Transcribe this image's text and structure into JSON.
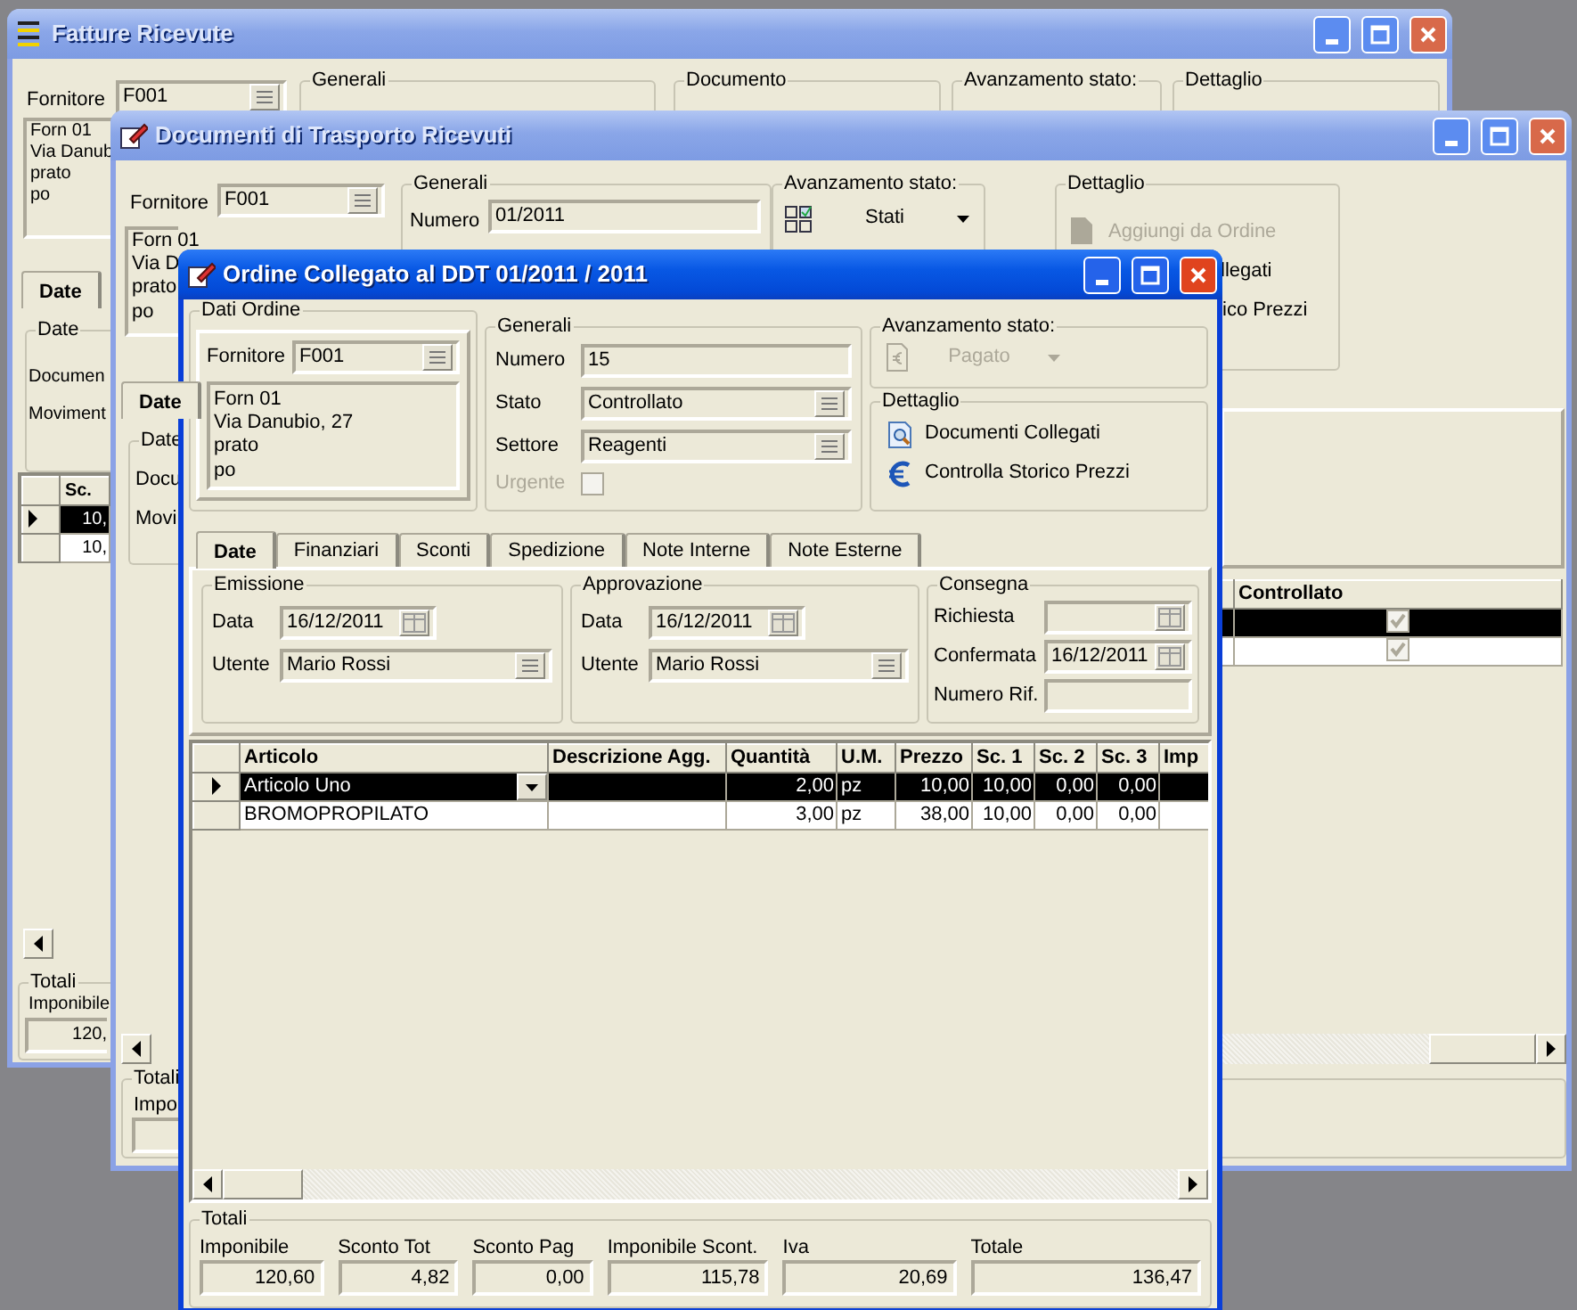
{
  "invoices_window": {
    "title": "Fatture Ricevute",
    "active": false,
    "supplier_label": "Fornitore",
    "supplier_code": "F001",
    "group_titles": [
      "Generali",
      "Documento",
      "Avanzamento stato:",
      "Dettaglio"
    ],
    "address_lines": [
      "Forn 01",
      "Via Danub",
      "prato",
      "po"
    ],
    "tab": {
      "label": "Date",
      "selected": true
    },
    "dates_group": "Date",
    "date_labels": [
      "Documen",
      "Moviment"
    ],
    "grid_column": "Sc.",
    "grid_rows": [
      {
        "value": "10,",
        "selected": true
      },
      {
        "value": "10,",
        "selected": false
      }
    ],
    "totals_title": "Totali",
    "totals_label": "Imponibile",
    "totals_value": "120,"
  },
  "transport_window": {
    "title": "Documenti di Trasporto Ricevuti",
    "active": false,
    "supplier_label": "Fornitore",
    "supplier_code": "F001",
    "address_lines": [
      "Forn 01",
      "Via D",
      "prato",
      "po"
    ],
    "general_title": "Generali",
    "number_label": "Numero",
    "number_value": "01/2011",
    "status_title": "Avanzamento stato:",
    "status_button": "Stati",
    "detail_title": "Dettaglio",
    "detail_actions": [
      {
        "label": "Aggiungi da Ordine",
        "disabled": true
      },
      {
        "label": "llegati",
        "disabled": false
      },
      {
        "label": "ico Prezzi",
        "disabled": false
      }
    ],
    "tab": {
      "label": "Date",
      "selected": true
    },
    "dates_group": "Date",
    "date_labels": [
      "Docu",
      "Movi"
    ],
    "grid_column": "Controllato",
    "grid_rows": [
      {
        "selected": true,
        "checked": true
      },
      {
        "selected": false,
        "checked": true
      }
    ],
    "totals_title": "Totali",
    "totals_label": "Impo"
  },
  "order_window": {
    "title": "Ordine Collegato al DDT 01/2011 / 2011",
    "active": true,
    "order_group": {
      "title": "Dati Ordine",
      "supplier_label": "Fornitore",
      "supplier_code": "F001",
      "address_lines": [
        "Forn 01",
        "Via Danubio, 27",
        "prato",
        "po"
      ]
    },
    "general_group": {
      "title": "Generali",
      "fields": [
        {
          "label": "Numero",
          "value": "15",
          "kind": "text"
        },
        {
          "label": "Stato",
          "value": "Controllato",
          "kind": "lookup"
        },
        {
          "label": "Settore",
          "value": "Reagenti",
          "kind": "lookup"
        }
      ],
      "urgent": {
        "label": "Urgente",
        "checked": false,
        "disabled": true
      }
    },
    "status_group": {
      "title": "Avanzamento stato:",
      "button": "Pagato",
      "disabled": true
    },
    "detail_group": {
      "title": "Dettaglio",
      "actions": [
        {
          "label": "Documenti Collegati",
          "kind": "documents"
        },
        {
          "label": "Controlla Storico Prezzi",
          "kind": "prices"
        }
      ]
    },
    "tabs": [
      {
        "label": "Date",
        "selected": true
      },
      {
        "label": "Finanziari",
        "selected": false
      },
      {
        "label": "Sconti",
        "selected": false
      },
      {
        "label": "Spedizione",
        "selected": false
      },
      {
        "label": "Note Interne",
        "selected": false
      },
      {
        "label": "Note Esterne",
        "selected": false
      }
    ],
    "emission": {
      "title": "Emissione",
      "date_label": "Data",
      "date": "16/12/2011",
      "user_label": "Utente",
      "user": "Mario Rossi"
    },
    "approval": {
      "title": "Approvazione",
      "date_label": "Data",
      "date": "16/12/2011",
      "user_label": "Utente",
      "user": "Mario Rossi"
    },
    "delivery": {
      "title": "Consegna",
      "fields": [
        {
          "label": "Richiesta",
          "kind": "date"
        },
        {
          "label": "Confermata",
          "value": "16/12/2011",
          "kind": "date"
        },
        {
          "label": "Numero Rif.",
          "kind": "text"
        }
      ]
    },
    "grid": {
      "columns": [
        "Articolo",
        "Descrizione Agg.",
        "Quantità",
        "U.M.",
        "Prezzo",
        "Sc. 1",
        "Sc. 2",
        "Sc. 3",
        "Imp"
      ],
      "rows": [
        {
          "article": "Articolo Uno",
          "quantity": "2,00",
          "unit": "pz",
          "price": "10,00",
          "discount_1": "10,00",
          "discount_2": "0,00",
          "discount_3": "0,00",
          "selected": true
        },
        {
          "article": "BROMOPROPILATO",
          "quantity": "3,00",
          "unit": "pz",
          "price": "38,00",
          "discount_1": "10,00",
          "discount_2": "0,00",
          "discount_3": "0,00",
          "selected": false
        }
      ]
    },
    "totals": {
      "title": "Totali",
      "items": [
        {
          "label": "Imponibile",
          "value": "120,60"
        },
        {
          "label": "Sconto Tot",
          "value": "4,82"
        },
        {
          "label": "Sconto Pag",
          "value": "0,00"
        },
        {
          "label": "Imponibile Scont.",
          "value": "115,78"
        },
        {
          "label": "Iva",
          "value": "20,69"
        },
        {
          "label": "Totale",
          "value": "136,47"
        }
      ]
    }
  }
}
